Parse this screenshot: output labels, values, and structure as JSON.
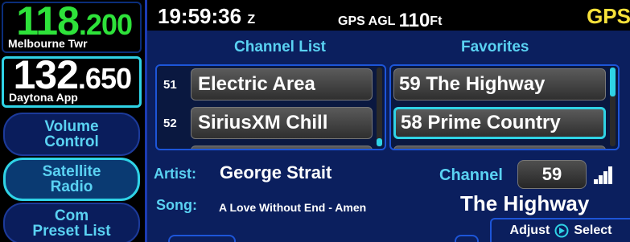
{
  "com": {
    "active": {
      "freq_main": "118",
      "freq_dec": ".200",
      "name": "Melbourne Twr"
    },
    "standby": {
      "freq_main": "132",
      "freq_dec": ".650",
      "name": "Daytona App"
    }
  },
  "side_buttons": {
    "volume": [
      "Volume",
      "Control"
    ],
    "satellite": [
      "Satellite",
      "Radio"
    ],
    "com_preset": [
      "Com",
      "Preset List"
    ]
  },
  "status": {
    "time": "19:59:36",
    "time_zone": "Z",
    "agl_prefix": "GPS AGL",
    "agl_value": "110",
    "agl_unit": "Ft",
    "nav_source": "GPS"
  },
  "channel_list": {
    "header": "Channel List",
    "items": [
      {
        "number": "51",
        "name": "Electric Area"
      },
      {
        "number": "52",
        "name": "SiriusXM Chill"
      }
    ]
  },
  "favorites": {
    "header": "Favorites",
    "items": [
      {
        "name": "59 The Highway"
      },
      {
        "name": "58 Prime Country"
      }
    ]
  },
  "now_playing": {
    "artist_label": "Artist:",
    "artist": "George Strait",
    "song_label": "Song:",
    "song": "A Love Without End - Amen",
    "channel_label": "Channel",
    "channel_number": "59",
    "station": "The Highway",
    "signal_bars": 4
  },
  "hint": {
    "adjust": "Adjust",
    "select": "Select"
  },
  "colors": {
    "cyan": "#5ad2f2",
    "green_freq": "#2ee23a",
    "yellow_nav": "#f7e13a",
    "panel_blue": "#0b1f5e"
  }
}
